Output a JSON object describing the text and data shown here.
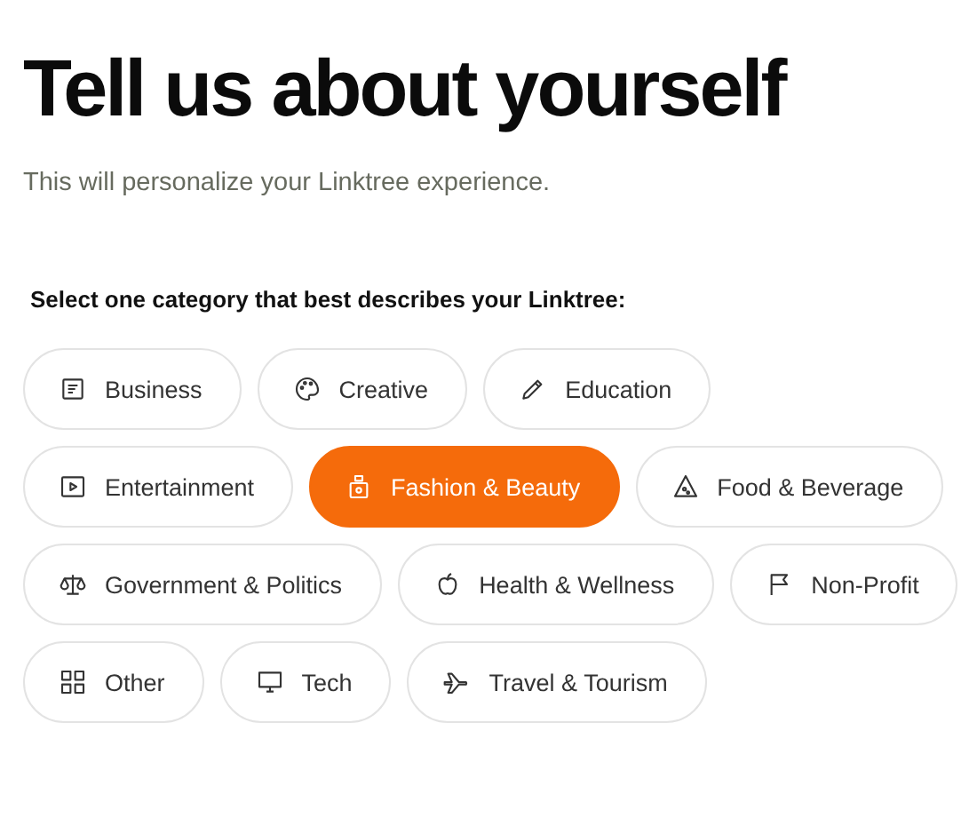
{
  "title": "Tell us about yourself",
  "subtitle": "This will personalize your Linktree experience.",
  "prompt": "Select one category that best describes your Linktree:",
  "categories": [
    {
      "label": "Business",
      "selected": false
    },
    {
      "label": "Creative",
      "selected": false
    },
    {
      "label": "Education",
      "selected": false
    },
    {
      "label": "Entertainment",
      "selected": false
    },
    {
      "label": "Fashion & Beauty",
      "selected": true
    },
    {
      "label": "Food & Beverage",
      "selected": false
    },
    {
      "label": "Government & Politics",
      "selected": false
    },
    {
      "label": "Health & Wellness",
      "selected": false
    },
    {
      "label": "Non-Profit",
      "selected": false
    },
    {
      "label": "Other",
      "selected": false
    },
    {
      "label": "Tech",
      "selected": false
    },
    {
      "label": "Travel & Tourism",
      "selected": false
    }
  ]
}
